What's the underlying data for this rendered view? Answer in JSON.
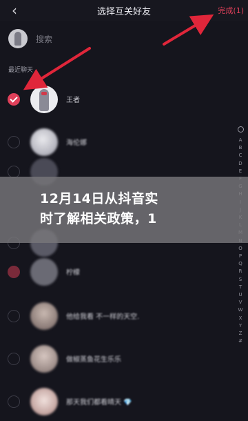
{
  "header": {
    "back_icon": "chevron-left-icon",
    "title": "选择互关好友",
    "done_label": "完成(1)"
  },
  "search": {
    "placeholder": "搜索"
  },
  "section_title": "最近聊天",
  "contacts": [
    {
      "name": "王者",
      "checked": true
    },
    {
      "name": "海伦娜",
      "checked": false
    },
    {
      "name": "",
      "checked": false
    },
    {
      "name": "",
      "checked": false
    },
    {
      "name": "",
      "checked": false
    },
    {
      "name": "柠檬",
      "checked": true
    },
    {
      "name": "他给我看 不一样的天空.",
      "checked": false
    },
    {
      "name": "做椒蒸鱼花生乐乐",
      "checked": false
    },
    {
      "name": "那天我们都看晴天 💎",
      "checked": false
    }
  ],
  "index_letters": [
    "A",
    "B",
    "C",
    "D",
    "E",
    "F",
    "G",
    "H",
    "I",
    "J",
    "K",
    "L",
    "M",
    "N",
    "O",
    "P",
    "Q",
    "R",
    "S",
    "T",
    "U",
    "V",
    "W",
    "X",
    "Y",
    "Z",
    "#"
  ],
  "banner": {
    "text": "12月14日从抖音实\n时了解相关政策，1"
  },
  "colors": {
    "accent": "#e0405a",
    "background": "#15151d",
    "annotation_arrow": "#e0263a"
  }
}
